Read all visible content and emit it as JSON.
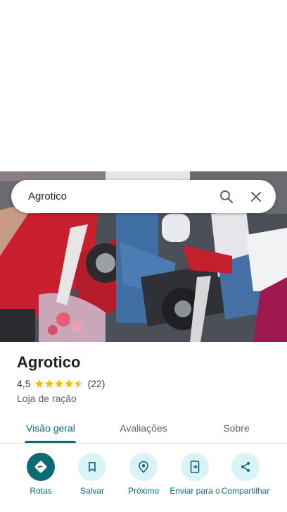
{
  "search": {
    "query": "Agrotico"
  },
  "place": {
    "name": "Agrotico",
    "rating": "4,5",
    "rating_value": 4.5,
    "review_count": "(22)",
    "category": "Loja de ração"
  },
  "tabs": [
    {
      "label": "Visão geral",
      "active": true
    },
    {
      "label": "Avaliações",
      "active": false
    },
    {
      "label": "Sobre",
      "active": false
    }
  ],
  "actions": [
    {
      "label": "Rotas",
      "icon": "directions-icon"
    },
    {
      "label": "Salvar",
      "icon": "bookmark-icon"
    },
    {
      "label": "Próximo",
      "icon": "nearby-icon"
    },
    {
      "label": "Enviar para o",
      "icon": "send-to-phone-icon"
    },
    {
      "label": "Compartilhar",
      "icon": "share-icon"
    }
  ],
  "colors": {
    "accent": "#0b6b73",
    "accent_light": "#d9f3f6",
    "star": "#fbbc04"
  }
}
